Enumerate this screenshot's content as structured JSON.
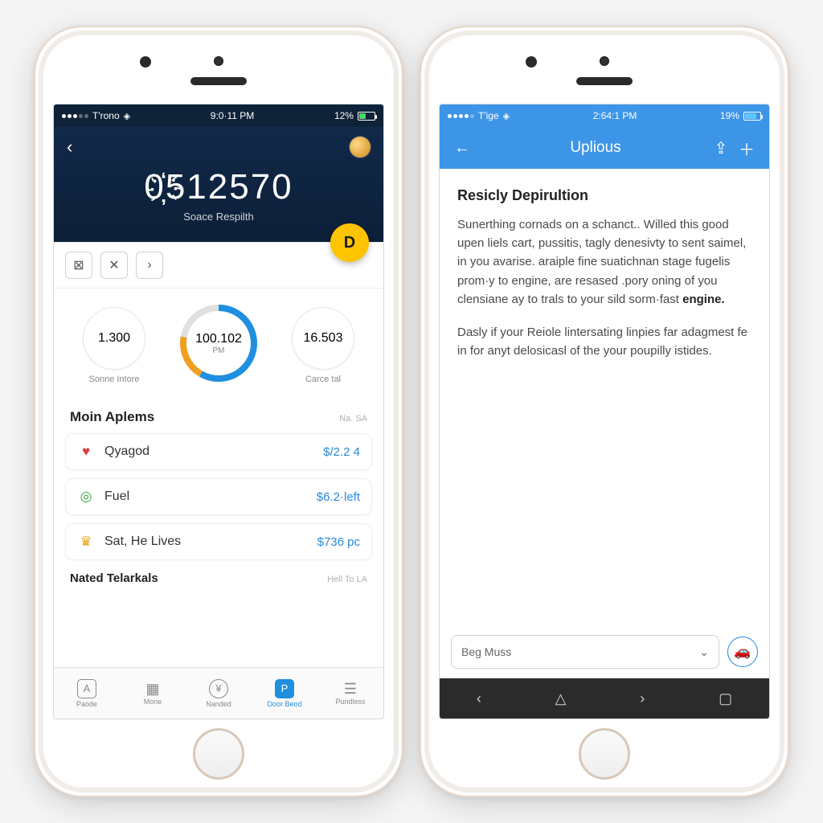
{
  "left": {
    "status": {
      "carrier": "T'rono",
      "time": "9:0·11 PM",
      "battery": "12%"
    },
    "header": {
      "balance": "0҉512570",
      "subtitle": "Soace Respilth"
    },
    "fab_label": "D",
    "gauges": [
      {
        "value": "1.300",
        "label": "Sonne Intore"
      },
      {
        "value": "100.102",
        "sub": "PM",
        "label": ""
      },
      {
        "value": "16.503",
        "label": "Carce tal"
      }
    ],
    "sections": {
      "main": {
        "title": "Moin Aplems",
        "meta": "Na. SA"
      },
      "second": {
        "title": "Nated Telarkals",
        "meta": "Hell To LA"
      }
    },
    "items": [
      {
        "icon": "heart",
        "title": "Qyagod",
        "amount": "$/2.2 4"
      },
      {
        "icon": "target",
        "title": "Fuel",
        "amount": "$6.2·left"
      },
      {
        "icon": "crown",
        "title": "Sat, He Lives",
        "amount": "$736 pc"
      }
    ],
    "tabs": [
      {
        "icon": "A",
        "label": "Paode"
      },
      {
        "icon": "grid",
        "label": "Mone"
      },
      {
        "icon": "coin",
        "label": "Nanded"
      },
      {
        "icon": "P",
        "label": "Door Beod",
        "active": true
      },
      {
        "icon": "menu",
        "label": "Pundless"
      }
    ]
  },
  "right": {
    "status": {
      "carrier": "T'ige",
      "time": "2:64:1 PM",
      "battery": "19%"
    },
    "header": {
      "title": "Uplious"
    },
    "article": {
      "heading": "Resicly Depirultion",
      "p1_a": "Sunerthing cornads on a schanct.. Willed this good upen liels cart, pussitis, tagly denesivty to sent saimel, in you avarise. araiple fine suatichnan stage fugelis prom·y to engine, are resased .pory oning of you clensiane ay to trals to your sild sorm·fast ",
      "p1_b": "engine.",
      "p2": "Dasly if your Reiole lintersating linpies far adagmest fe in for anyt delosicasl of the your poupilly istides."
    },
    "select_label": "Beg Muss"
  }
}
